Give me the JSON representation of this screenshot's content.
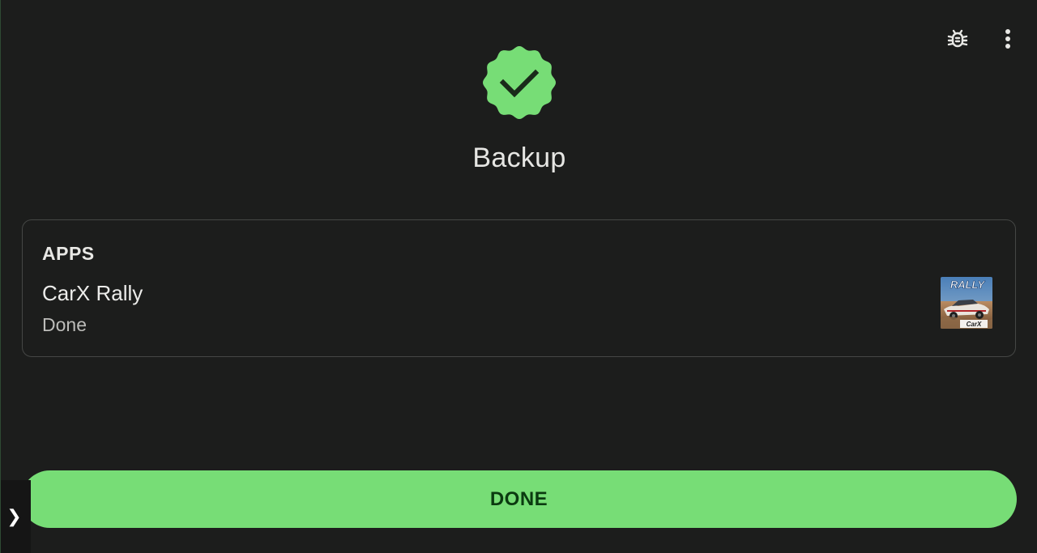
{
  "screen": {
    "title": "Backup",
    "status_icon": "check-badge-icon"
  },
  "top_actions": {
    "debug_icon": "bug-icon",
    "more_icon": "more-vert-icon"
  },
  "card": {
    "section_header": "APPS",
    "app": {
      "name": "CarX Rally",
      "status": "Done",
      "icon": "carx-rally-app-icon",
      "icon_text": "RALLY",
      "icon_brand": "CarX"
    }
  },
  "footer": {
    "done_label": "DONE"
  },
  "side_handle": {
    "glyph": "❯"
  },
  "colors": {
    "background": "#1c1d1c",
    "accent_green": "#77dd76",
    "button_text": "#0b3a10",
    "card_border": "#454745",
    "text_primary": "#ececea",
    "text_secondary": "#bdbdba"
  }
}
